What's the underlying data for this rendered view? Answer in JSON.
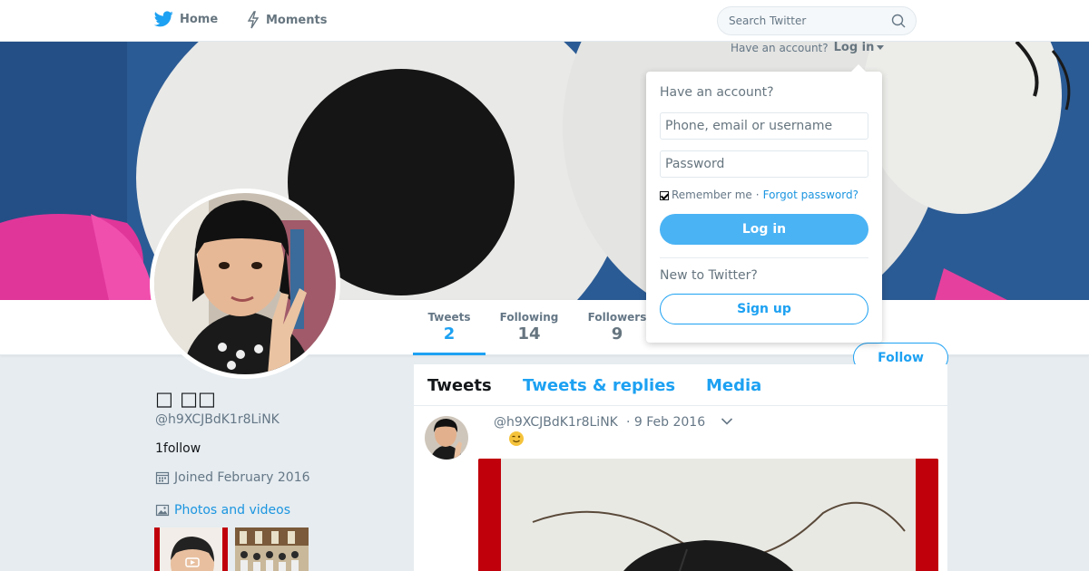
{
  "nav": {
    "home_label": "Home",
    "moments_label": "Moments",
    "search_placeholder": "Search Twitter"
  },
  "profile": {
    "name": "□ □□",
    "handle": "@h9XCJBdK1r8LiNK",
    "bio": "1follow",
    "joined": "Joined February 2016",
    "photos_label": "Photos and videos"
  },
  "stats": {
    "tweets_label": "Tweets",
    "tweets_value": "2",
    "following_label": "Following",
    "following_value": "14",
    "followers_label": "Followers",
    "followers_value": "9"
  },
  "follow_label": "Follow",
  "timeline": {
    "tabs": [
      "Tweets",
      "Tweets & replies",
      "Media"
    ],
    "tweet": {
      "handle": "@h9XCJBdK1r8LiNK",
      "date": "· 9 Feb 2016",
      "emoji": "😉"
    }
  },
  "login": {
    "have_account": "Have an account?",
    "login_link": "Log in",
    "title": "Have an account?",
    "user_placeholder": "Phone, email or username",
    "pass_placeholder": "Password",
    "remember": "Remember me",
    "separator": "·",
    "forgot": "Forgot password?",
    "login_button": "Log in",
    "new_to": "New to Twitter?",
    "signup_button": "Sign up"
  },
  "colors": {
    "accent": "#1da1f2",
    "login_button": "#4ab3f4",
    "background": "#e6ecf0"
  }
}
